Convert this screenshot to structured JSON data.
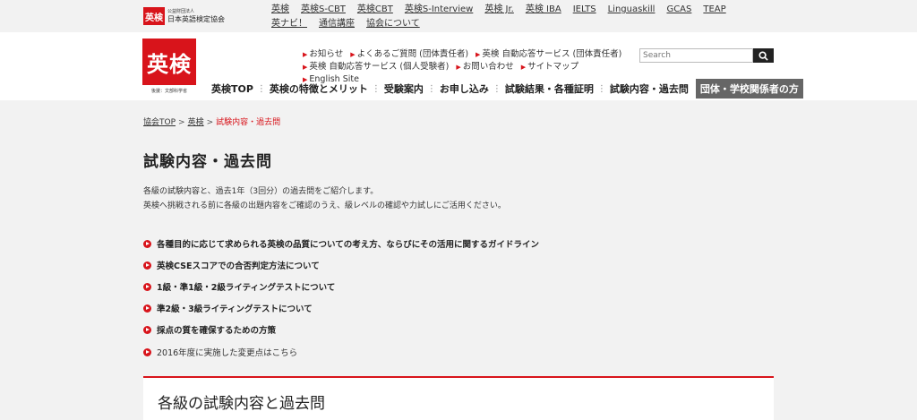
{
  "org": {
    "mark": "英検",
    "sub": "公益財団法人",
    "name": "日本英語検定協会"
  },
  "top_links": [
    "英検",
    "英検S-CBT",
    "英検CBT",
    "英検S-Interview",
    "英検 Jr.",
    "英検 IBA",
    "IELTS",
    "Linguaskill",
    "GCAS",
    "TEAP",
    "英ナビ！",
    "通信講座",
    "協会について"
  ],
  "logo": {
    "text": "英検",
    "sponsor": "後援：文部科学省"
  },
  "util_links": [
    "お知らせ",
    "よくあるご質問 (団体責任者)",
    "英検 自動応答サービス (団体責任者)",
    "英検 自動応答サービス (個人受験者)",
    "お問い合わせ",
    "サイトマップ",
    "English Site"
  ],
  "search": {
    "placeholder": "Search"
  },
  "global_nav": [
    "英検TOP",
    "英検の特徴とメリット",
    "受験案内",
    "お申し込み",
    "試験結果・各種証明",
    "試験内容・過去問",
    "団体・学校関係者の方"
  ],
  "breadcrumb": {
    "home": "協会TOP",
    "parent": "英検",
    "current": "試験内容・過去問"
  },
  "page_title": "試験内容・過去問",
  "intro": [
    "各級の試験内容と、過去1年（3回分）の過去問をご紹介します。",
    "英検へ挑戦される前に各級の出題内容をご確認のうえ、級レベルの確認や力試しにご活用ください。"
  ],
  "guides": [
    "各種目的に応じて求められる英検の品質についての考え方、ならびにその活用に関するガイドライン",
    "英検CSEスコアでの合否判定方法について",
    "1級・準1級・2級ライティングテストについて",
    "準2級・3級ライティングテストについて",
    "採点の質を確保するための方策"
  ],
  "change_link": "2016年度に実施した変更点はこちら",
  "section_title": "各級の試験内容と過去問",
  "colors": {
    "accent": "#d8141b"
  }
}
